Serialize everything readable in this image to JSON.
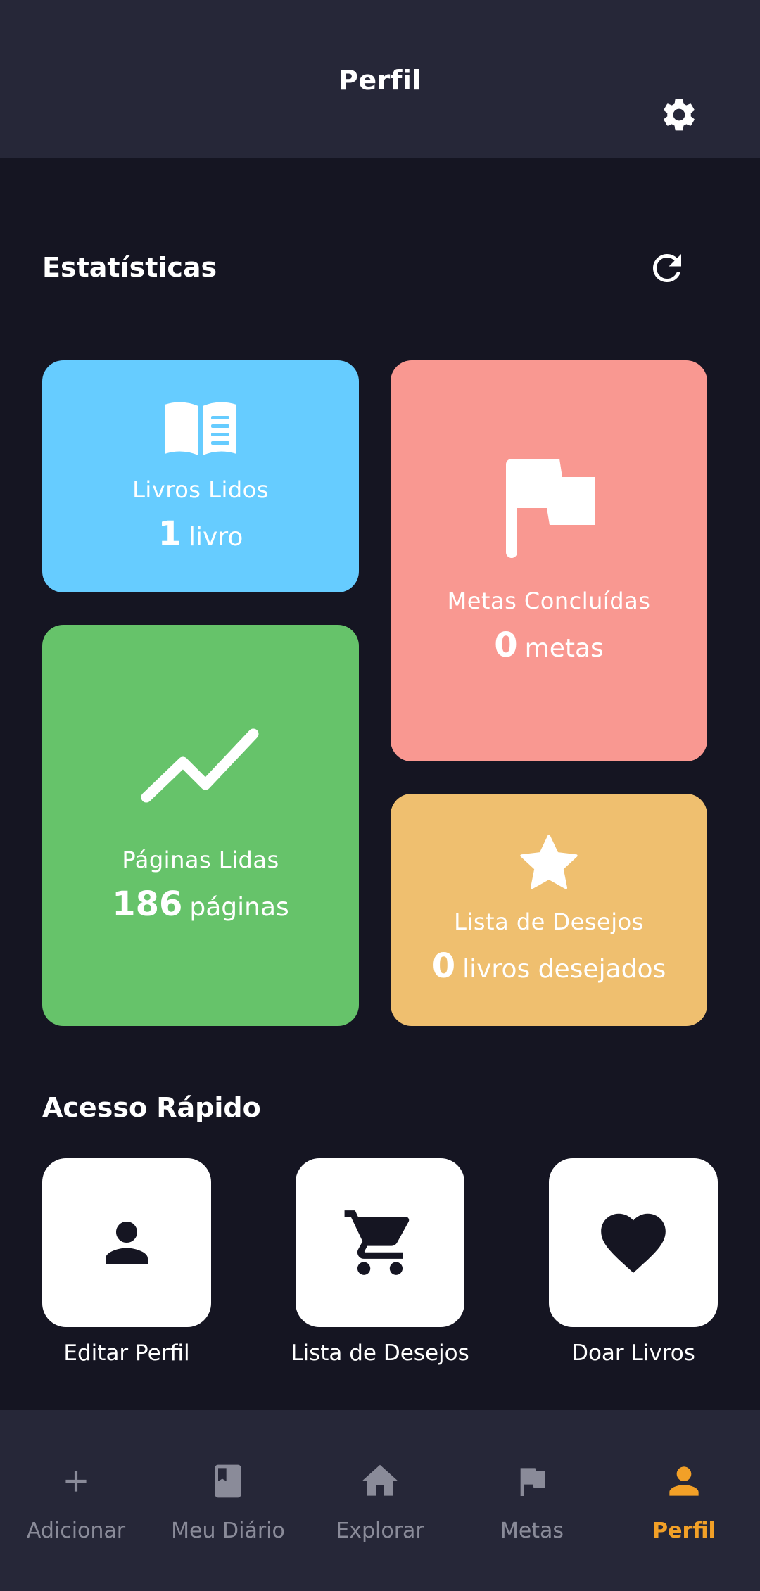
{
  "appbar": {
    "title": "Perfil",
    "settings_icon": "gear-icon"
  },
  "stats": {
    "title": "Estatísticas",
    "refresh_icon": "refresh-icon",
    "cards": {
      "books_read": {
        "label": "Livros Lidos",
        "value": "1",
        "unit": "livro",
        "color": "#66ccff",
        "icon": "open-book-icon"
      },
      "goals_done": {
        "label": "Metas Concluídas",
        "value": "0",
        "unit": "metas",
        "color": "#f99891",
        "icon": "flag-icon"
      },
      "pages_read": {
        "label": "Páginas Lidas",
        "value": "186",
        "unit": "páginas",
        "color": "#66c36a",
        "icon": "trending-up-icon"
      },
      "wishlist": {
        "label": "Lista de Desejos",
        "value": "0",
        "unit": "livros desejados",
        "color": "#efbf6f",
        "icon": "star-icon"
      }
    }
  },
  "quick_access": {
    "title": "Acesso Rápido",
    "items": [
      {
        "label": "Editar Perfil",
        "icon": "person-icon"
      },
      {
        "label": "Lista de Desejos",
        "icon": "cart-icon"
      },
      {
        "label": "Doar Livros",
        "icon": "heart-icon"
      }
    ]
  },
  "nav": {
    "items": [
      {
        "label": "Adicionar",
        "icon": "plus-icon"
      },
      {
        "label": "Meu Diário",
        "icon": "book-icon"
      },
      {
        "label": "Explorar",
        "icon": "home-icon"
      },
      {
        "label": "Metas",
        "icon": "flag-icon"
      },
      {
        "label": "Perfil",
        "icon": "person-icon",
        "active": true
      }
    ],
    "active_color": "#f2a027",
    "inactive_color": "#8a8b99"
  }
}
